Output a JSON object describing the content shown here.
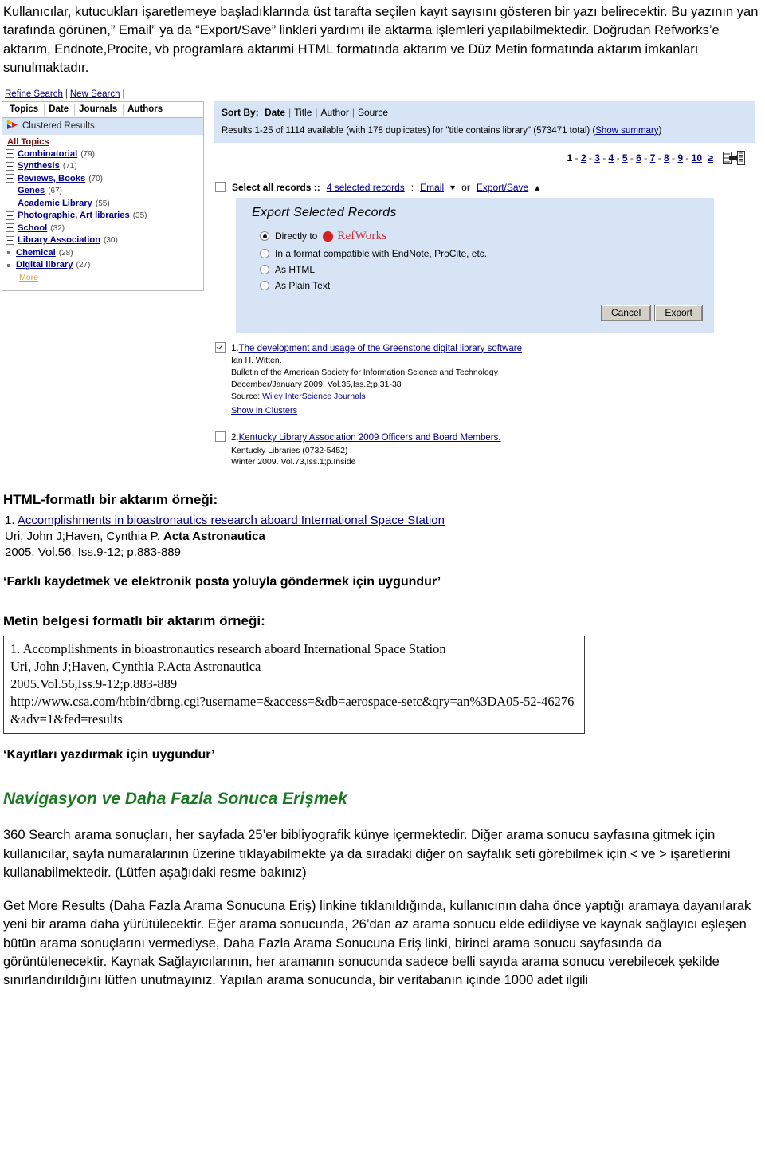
{
  "intro": {
    "paragraph": "Kullanıcılar, kutucukları işaretlemeye başladıklarında üst tarafta seçilen kayıt sayısını gösteren bir yazı belirecektir. Bu yazının yan tarafında görünen,” Email” ya da “Export/Save” linkleri yardımı ile aktarma işlemleri yapılabilmektedir. Doğrudan Refworks’e aktarım, Endnote,Procite, vb programlara aktarımi HTML formatında aktarım ve Düz Metin formatında aktarım imkanları sunulmaktadır."
  },
  "screenshot": {
    "toplinks": {
      "refine": "Refine Search",
      "new": "New Search",
      "sep": "|"
    },
    "facets": {
      "tabs": [
        {
          "label": "Topics"
        },
        {
          "label": "Date"
        },
        {
          "label": "Journals"
        },
        {
          "label": "Authors"
        }
      ],
      "clustered_label": "Clustered Results",
      "all_topics": "All Topics",
      "items": [
        {
          "label": "Combinatorial",
          "count": "(79)",
          "expandable": true
        },
        {
          "label": "Synthesis",
          "count": "(71)",
          "expandable": true
        },
        {
          "label": "Reviews, Books",
          "count": "(70)",
          "expandable": true
        },
        {
          "label": "Genes",
          "count": "(67)",
          "expandable": true
        },
        {
          "label": "Academic Library",
          "count": "(55)",
          "expandable": true
        },
        {
          "label": "Photographic, Art libraries",
          "count": "(35)",
          "expandable": true
        },
        {
          "label": "School",
          "count": "(32)",
          "expandable": true
        },
        {
          "label": "Library Association",
          "count": "(30)",
          "expandable": true
        },
        {
          "label": "Chemical",
          "count": "(28)",
          "expandable": false
        },
        {
          "label": "Digital library",
          "count": "(27)",
          "expandable": false
        }
      ],
      "more": "More"
    },
    "sortbar": {
      "label": "Sort By:",
      "options": [
        "Date",
        "Title",
        "Author",
        "Source"
      ]
    },
    "results_summary": {
      "text": "Results 1-25 of 1114 available (with 178 duplicates) for \"title contains library\" (573471 total) (",
      "show_summary": "Show summary",
      "tail": ")"
    },
    "pager": {
      "pages": [
        "1",
        "2",
        "3",
        "4",
        "5",
        "6",
        "7",
        "8",
        "9",
        "10"
      ],
      "current": "1",
      "next": "≥"
    },
    "select_row": {
      "label": "Select all records ::",
      "selected": "4 selected records",
      "colon": ":",
      "email": "Email",
      "or": "or",
      "export_save": "Export/Save"
    },
    "export_panel": {
      "title": "Export Selected Records",
      "options": [
        {
          "label": "Directly to",
          "brand": "RefWorks",
          "selected": true
        },
        {
          "label": "In a format compatible with EndNote, ProCite, etc.",
          "selected": false
        },
        {
          "label": "As HTML",
          "selected": false
        },
        {
          "label": "As Plain Text",
          "selected": false
        }
      ],
      "cancel": "Cancel",
      "export": "Export"
    },
    "records": [
      {
        "checked": true,
        "num": "1.",
        "title": "The development and usage of the Greenstone digital library software",
        "lines": [
          "Ian H. Witten.",
          "Bulletin of the American Society for Information Science and Technology",
          "December/January 2009. Vol.35,Iss.2;p.31-38"
        ],
        "source_label": "Source:",
        "source_link": "Wiley InterScience Journals",
        "clusters_link": "Show In Clusters"
      },
      {
        "checked": false,
        "num": "2.",
        "title": "Kentucky Library Association 2009 Officers and Board Members.",
        "lines": [
          "Kentucky Libraries (0732-5452)",
          "Winter 2009. Vol.73,Iss.1;p.Inside"
        ],
        "source_label": "",
        "source_link": "",
        "clusters_link": ""
      }
    ]
  },
  "html_section": {
    "heading": "HTML-formatlı bir aktarım örneği:",
    "num": "1.",
    "title": "Accomplishments in bioastronautics research aboard International Space Station",
    "authors": "Uri, John J;Haven, Cynthia P.",
    "journal": "Acta Astronautica",
    "citation": "2005. Vol.56, Iss.9-12; p.883-889",
    "quote": "‘Farklı kaydetmek ve elektronik posta yoluyla göndermek için uygundur’"
  },
  "text_section": {
    "heading": "Metin belgesi formatlı bir aktarım örneği:",
    "lines": [
      "1. Accomplishments in bioastronautics research aboard International Space Station",
      "Uri, John J;Haven, Cynthia P.Acta Astronautica",
      "2005.Vol.56,Iss.9-12;p.883-889",
      "http://www.csa.com/htbin/dbrng.cgi?username=&access=&db=aerospace-setc&qry=an%3DA05-52-46276&adv=1&fed=results"
    ],
    "quote": "‘Kayıtları yazdırmak için uygundur’"
  },
  "nav_section": {
    "heading": "Navigasyon ve Daha Fazla Sonuca Erişmek",
    "paragraph1": "360 Search arama sonuçları, her sayfada 25’er bibliyografik künye içermektedir. Diğer arama sonucu sayfasına gitmek için kullanıcılar, sayfa numaralarının üzerine tıklayabilmekte ya da sıradaki diğer on sayfalık seti görebilmek için < ve > işaretlerini kullanabilmektedir. (Lütfen aşağıdaki resme bakınız)",
    "paragraph2": "Get More Results (Daha Fazla Arama Sonucuna Eriş) linkine tıklanıldığında, kullanıcının daha önce yaptığı aramaya dayanılarak yeni bir arama daha yürütülecektir. Eğer arama sonucunda, 26’dan az arama sonucu elde edildiyse ve kaynak sağlayıcı eşleşen bütün arama sonuçlarını vermediyse, Daha Fazla Arama Sonucuna Eriş linki, birinci arama sonucu sayfasında da görüntülenecektir. Kaynak Sağlayıcılarının, her aramanın sonucunda sadece belli sayıda arama sonucu verebilecek şekilde sınırlandırıldığını lütfen unutmayınız. Yapılan arama sonucunda, bir veritabanın içinde 1000 adet ilgili"
  },
  "colors": {
    "panel_blue": "#d6e4f5",
    "link_navy": "#00008b",
    "heading_green": "#1a7a22",
    "refworks_red": "#c8303a",
    "all_topics_red": "#7a1010",
    "more_gold": "#d3a24a"
  }
}
